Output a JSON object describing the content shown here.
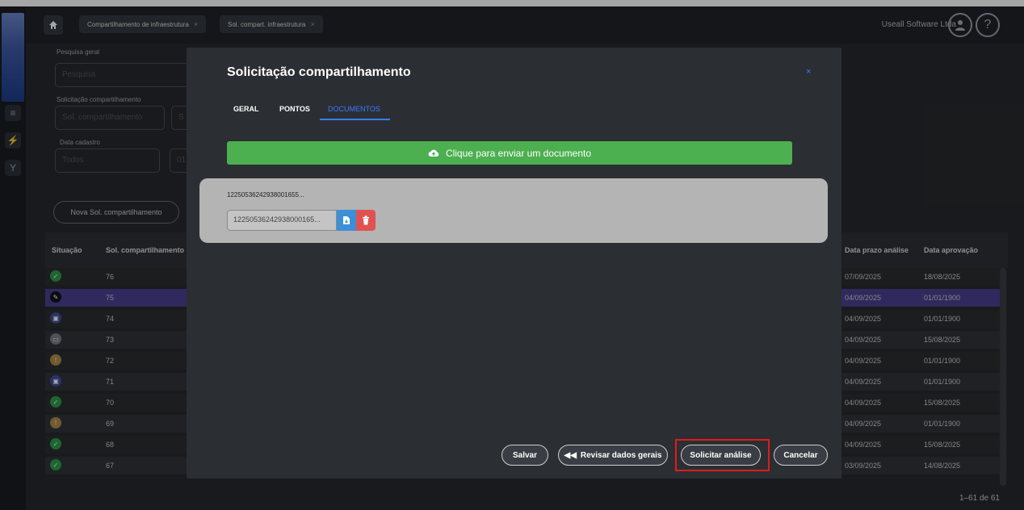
{
  "topbar": {
    "tabs": [
      {
        "label": "Compartilhamento de infraestrutura"
      },
      {
        "label": "Sol. compart. infraestrutura"
      }
    ],
    "company": "Useall Software Ltda",
    "help_label": "?"
  },
  "filters": {
    "general_search_label": "Pesquisa geral",
    "general_search_placeholder": "Pesquisa",
    "request_label": "Solicitação compartilhamento",
    "request_placeholder": "Sol. compartilhamento",
    "date_label": "Data cadastro",
    "date_value": "Todos",
    "date_partial": "01"
  },
  "new_button": "Nova Sol. compartilhamento",
  "table": {
    "headers": {
      "status": "Situação",
      "request": "Sol. compartilhamento",
      "deadline": "Data prazo análise",
      "approval": "Data aprovação"
    },
    "rows": [
      {
        "id": "76",
        "status": "approved",
        "deadline": "07/09/2025",
        "approval": "18/08/2025"
      },
      {
        "id": "75",
        "status": "editing",
        "deadline": "04/09/2025",
        "approval": "01/01/1900"
      },
      {
        "id": "74",
        "status": "submitted",
        "deadline": "04/09/2025",
        "approval": "01/01/1900"
      },
      {
        "id": "73",
        "status": "archived",
        "deadline": "04/09/2025",
        "approval": "15/08/2025"
      },
      {
        "id": "72",
        "status": "pending",
        "deadline": "04/09/2025",
        "approval": "01/01/1900"
      },
      {
        "id": "71",
        "status": "submitted",
        "deadline": "04/09/2025",
        "approval": "01/01/1900"
      },
      {
        "id": "70",
        "status": "approved",
        "deadline": "04/09/2025",
        "approval": "15/08/2025"
      },
      {
        "id": "69",
        "status": "pending",
        "deadline": "04/09/2025",
        "approval": "01/01/1900"
      },
      {
        "id": "68",
        "status": "approved",
        "deadline": "04/09/2025",
        "approval": "15/08/2025"
      },
      {
        "id": "67",
        "status": "approved",
        "deadline": "03/09/2025",
        "approval": "14/08/2025"
      }
    ],
    "pagination": "1–61 de 61"
  },
  "modal": {
    "title": "Solicitação compartilhamento",
    "close": "×",
    "tabs": [
      "GERAL",
      "PONTOS",
      "DOCUMENTOS"
    ],
    "upload_label": "Clique para enviar um documento",
    "doc_name": "12250536242938001655...",
    "doc_field": "12250536242938000165...",
    "buttons": {
      "save": "Salvar",
      "review": "Revisar dados gerais",
      "request_analysis": "Solicitar análise",
      "cancel": "Cancelar"
    }
  },
  "colors": {
    "accent": "#3b7bff",
    "upload_green": "#4caf50",
    "selected_row": "#4a3f90",
    "highlight": "#e01b1b"
  }
}
